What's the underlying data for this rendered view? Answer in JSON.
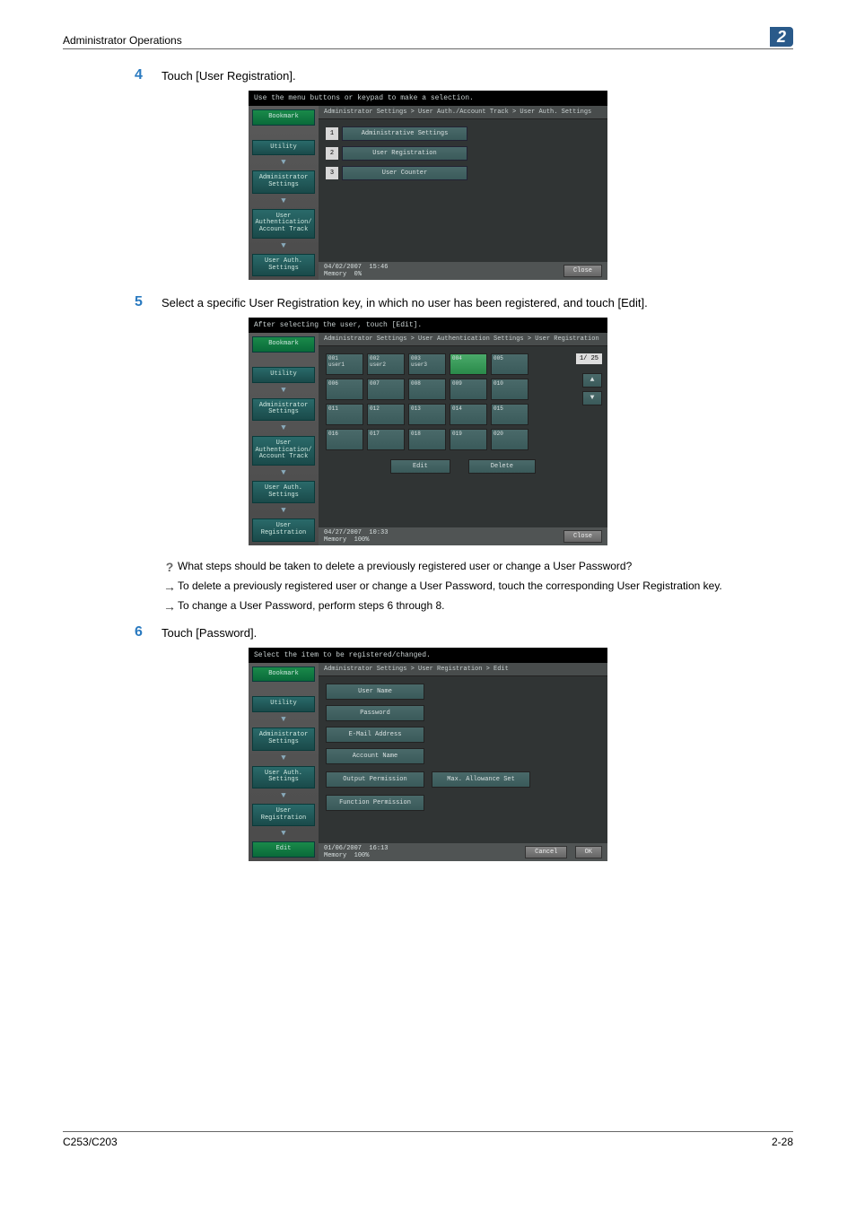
{
  "header": {
    "title": "Administrator Operations",
    "chapter": "2"
  },
  "footer": {
    "left": "C253/C203",
    "right": "2-28"
  },
  "step4": {
    "num": "4",
    "text": "Touch [User Registration]."
  },
  "step5": {
    "num": "5",
    "text": "Select a specific User Registration key, in which no user has been registered, and touch [Edit]."
  },
  "step6": {
    "num": "6",
    "text": "Touch [Password]."
  },
  "qa": {
    "q": "What steps should be taken to delete a previously registered user or change a User Password?",
    "a1": "To delete a previously registered user or change a User Password, touch the corresponding User Registration key.",
    "a2": "To change a User Password, perform steps 6 through 8."
  },
  "panel1": {
    "instr": "Use the menu buttons or keypad to make a selection.",
    "crumb": "Administrator Settings > User Auth./Account Track > User Auth. Settings",
    "side": {
      "bookmark": "Bookmark",
      "utility": "Utility",
      "admin": "Administrator Settings",
      "uaat": "User Authentication/ Account Track",
      "uas": "User Auth. Settings"
    },
    "menu": {
      "i1_n": "1",
      "i1": "Administrative Settings",
      "i2_n": "2",
      "i2": "User Registration",
      "i3_n": "3",
      "i3": "User Counter"
    },
    "footer": {
      "date": "04/02/2007",
      "time": "15:46",
      "mem": "Memory",
      "memv": "0%",
      "close": "Close"
    }
  },
  "panel2": {
    "instr": "After selecting the user, touch [Edit].",
    "crumb": "Administrator Settings > User Authentication Settings > User Registration",
    "side": {
      "bookmark": "Bookmark",
      "utility": "Utility",
      "admin": "Administrator Settings",
      "uaat": "User Authentication/ Account Track",
      "uas": "User Auth. Settings",
      "ur": "User Registration"
    },
    "page": "1/ 25",
    "slots": [
      {
        "n": "001",
        "u": "user1"
      },
      {
        "n": "002",
        "u": "user2"
      },
      {
        "n": "003",
        "u": "user3"
      },
      {
        "n": "004",
        "u": "",
        "sel": true
      },
      {
        "n": "005",
        "u": ""
      },
      {
        "n": "006",
        "u": ""
      },
      {
        "n": "007",
        "u": ""
      },
      {
        "n": "008",
        "u": ""
      },
      {
        "n": "009",
        "u": ""
      },
      {
        "n": "010",
        "u": ""
      },
      {
        "n": "011",
        "u": ""
      },
      {
        "n": "012",
        "u": ""
      },
      {
        "n": "013",
        "u": ""
      },
      {
        "n": "014",
        "u": ""
      },
      {
        "n": "015",
        "u": ""
      },
      {
        "n": "016",
        "u": ""
      },
      {
        "n": "017",
        "u": ""
      },
      {
        "n": "018",
        "u": ""
      },
      {
        "n": "019",
        "u": ""
      },
      {
        "n": "020",
        "u": ""
      }
    ],
    "edit": "Edit",
    "delete": "Delete",
    "footer": {
      "date": "04/27/2007",
      "time": "10:33",
      "mem": "Memory",
      "memv": "100%",
      "close": "Close"
    }
  },
  "panel3": {
    "instr": "Select the item to be registered/changed.",
    "crumb": "Administrator Settings > User Registration > Edit",
    "side": {
      "bookmark": "Bookmark",
      "utility": "Utility",
      "admin": "Administrator Settings",
      "uas": "User Auth. Settings",
      "ur": "User Registration",
      "edit": "Edit"
    },
    "fields": {
      "uname": "User Name",
      "pwd": "Password",
      "email": "E-Mail Address",
      "acct": "Account Name",
      "out": "Output Permission",
      "max": "Max. Allowance Set",
      "func": "Function Permission"
    },
    "footer": {
      "date": "01/06/2007",
      "time": "16:13",
      "mem": "Memory",
      "memv": "100%",
      "cancel": "Cancel",
      "ok": "OK"
    }
  }
}
